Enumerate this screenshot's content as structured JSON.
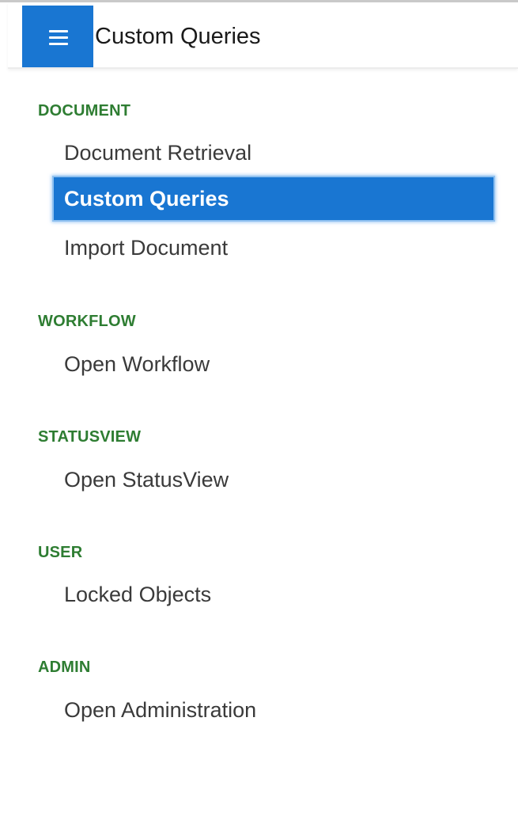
{
  "header": {
    "menu_icon": "hamburger-icon",
    "title": "Custom Queries"
  },
  "colors": {
    "accent": "#1976d2",
    "section_header": "#2e7d32",
    "item_text": "#3a3a3a"
  },
  "nav": {
    "sections": [
      {
        "header": "DOCUMENT",
        "items": [
          {
            "label": "Document Retrieval",
            "selected": false
          },
          {
            "label": "Custom Queries",
            "selected": true
          },
          {
            "label": "Import Document",
            "selected": false
          }
        ]
      },
      {
        "header": "WORKFLOW",
        "items": [
          {
            "label": "Open Workflow",
            "selected": false
          }
        ]
      },
      {
        "header": "STATUSVIEW",
        "items": [
          {
            "label": "Open StatusView",
            "selected": false
          }
        ]
      },
      {
        "header": "USER",
        "items": [
          {
            "label": "Locked Objects",
            "selected": false
          }
        ]
      },
      {
        "header": "ADMIN",
        "items": [
          {
            "label": "Open Administration",
            "selected": false
          }
        ]
      }
    ]
  }
}
